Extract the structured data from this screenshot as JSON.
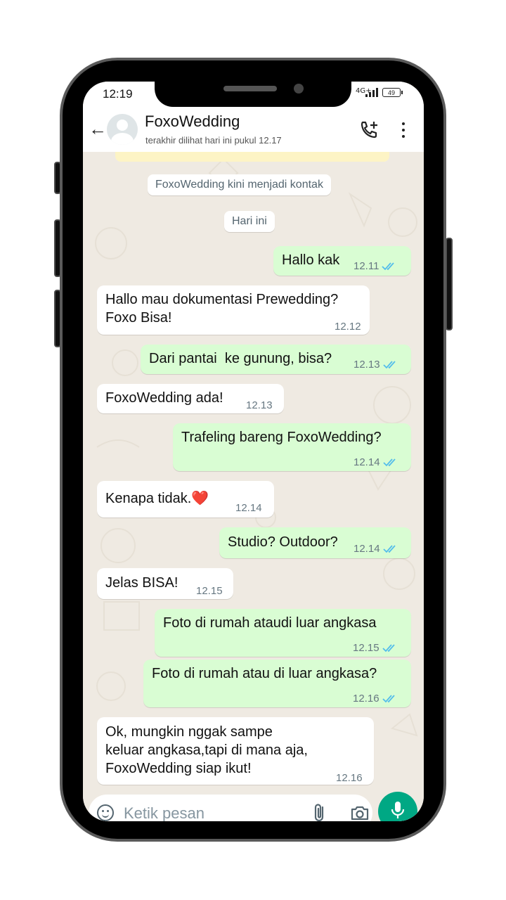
{
  "status_bar": {
    "time": "12:19",
    "network": "4G+",
    "battery": "49"
  },
  "header": {
    "contact_name": "FoxoWedding",
    "last_seen": "terakhir dilihat hari ini pukul 12.17"
  },
  "chat": {
    "system_notice": "FoxoWedding kini menjadi kontak",
    "date_label": "Hari ini",
    "messages": [
      {
        "direction": "out",
        "text": "Hallo kak",
        "time": "12.11",
        "read": true
      },
      {
        "direction": "in",
        "text": "Hallo mau dokumentasi Prewedding?\nFoxo Bisa!",
        "time": "12.12"
      },
      {
        "direction": "out",
        "text": "Dari pantai  ke gunung, bisa?",
        "time": "12.13",
        "read": true
      },
      {
        "direction": "in",
        "text": "FoxoWedding ada!",
        "time": "12.13"
      },
      {
        "direction": "out",
        "text": "Trafeling bareng FoxoWedding?",
        "time": "12.14",
        "read": true
      },
      {
        "direction": "in",
        "text": "Kenapa tidak.❤️",
        "time": "12.14"
      },
      {
        "direction": "out",
        "text": "Studio? Outdoor?",
        "time": "12.14",
        "read": true
      },
      {
        "direction": "in",
        "text": "Jelas BISA!",
        "time": "12.15"
      },
      {
        "direction": "out",
        "text": "Foto di rumah ataudi luar angkasa",
        "time": "12.15",
        "read": true
      },
      {
        "direction": "out",
        "text": "Foto di rumah atau di luar angkasa?",
        "time": "12.16",
        "read": true
      },
      {
        "direction": "in",
        "text": "Ok, mungkin nggak sampe\nkeluar angkasa,tapi di mana aja,\nFoxoWedding siap ikut!",
        "time": "12.16"
      }
    ]
  },
  "input_bar": {
    "placeholder": "Ketik pesan"
  },
  "colors": {
    "outgoing_bubble": "#d9fdd3",
    "incoming_bubble": "#ffffff",
    "chat_background": "#efeae2",
    "read_tick": "#53bdeb",
    "accent": "#00a884"
  },
  "icons": [
    "back-arrow-icon",
    "avatar-placeholder-icon",
    "add-call-icon",
    "more-options-icon",
    "emoji-icon",
    "attach-icon",
    "camera-icon",
    "mic-icon",
    "double-check-icon"
  ]
}
